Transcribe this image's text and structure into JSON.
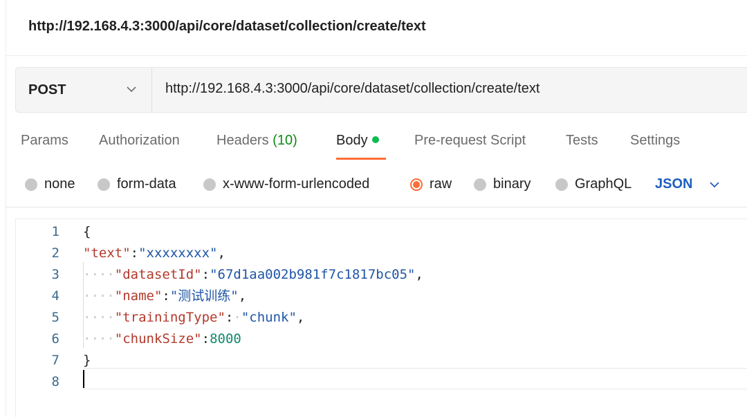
{
  "request": {
    "title": "http://192.168.4.3:3000/api/core/dataset/collection/create/text",
    "method": "POST",
    "url": "http://192.168.4.3:3000/api/core/dataset/collection/create/text"
  },
  "tabs": [
    {
      "label": "Params"
    },
    {
      "label": "Authorization"
    },
    {
      "label": "Headers",
      "count": "(10)"
    },
    {
      "label": "Body"
    },
    {
      "label": "Pre-request Script"
    },
    {
      "label": "Tests"
    },
    {
      "label": "Settings"
    }
  ],
  "body_types": [
    {
      "label": "none"
    },
    {
      "label": "form-data"
    },
    {
      "label": "x-www-form-urlencoded"
    },
    {
      "label": "raw"
    },
    {
      "label": "binary"
    },
    {
      "label": "GraphQL"
    }
  ],
  "selected_body_type": "raw",
  "raw_format": "JSON",
  "editor": {
    "line_numbers": [
      "1",
      "2",
      "3",
      "4",
      "5",
      "6",
      "7",
      "8"
    ],
    "lines": [
      {
        "parts": [
          {
            "t": "p",
            "v": "{"
          }
        ]
      },
      {
        "parts": [
          {
            "t": "k",
            "v": "\"text\""
          },
          {
            "t": "p",
            "v": ":"
          },
          {
            "t": "s",
            "v": "\"xxxxxxxx\""
          },
          {
            "t": "p",
            "v": ","
          }
        ]
      },
      {
        "parts": [
          {
            "t": "ws",
            "v": "····"
          },
          {
            "t": "k",
            "v": "\"datasetId\""
          },
          {
            "t": "p",
            "v": ":"
          },
          {
            "t": "s",
            "v": "\"67d1aa002b981f7c1817bc05\""
          },
          {
            "t": "p",
            "v": ","
          }
        ]
      },
      {
        "parts": [
          {
            "t": "ws",
            "v": "····"
          },
          {
            "t": "k",
            "v": "\"name\""
          },
          {
            "t": "p",
            "v": ":"
          },
          {
            "t": "s",
            "v": "\"测试训练\""
          },
          {
            "t": "p",
            "v": ","
          }
        ]
      },
      {
        "parts": [
          {
            "t": "ws",
            "v": "····"
          },
          {
            "t": "k",
            "v": "\"trainingType\""
          },
          {
            "t": "p",
            "v": ":"
          },
          {
            "t": "ws",
            "v": "·"
          },
          {
            "t": "s",
            "v": "\"chunk\""
          },
          {
            "t": "p",
            "v": ","
          }
        ]
      },
      {
        "parts": [
          {
            "t": "ws",
            "v": "····"
          },
          {
            "t": "k",
            "v": "\"chunkSize\""
          },
          {
            "t": "p",
            "v": ":"
          },
          {
            "t": "n",
            "v": "8000"
          }
        ]
      },
      {
        "parts": [
          {
            "t": "p",
            "v": "}"
          }
        ]
      },
      {
        "parts": []
      }
    ]
  },
  "colors": {
    "accent": "#ff6c37",
    "active_dot": "#0cbb52",
    "json_link": "#1f5fbf",
    "key": "#b2392b",
    "string": "#1f55a6",
    "number": "#0e8a6a"
  },
  "icons": {
    "method_dropdown": "chevron-down-icon",
    "format_dropdown": "chevron-down-icon"
  }
}
